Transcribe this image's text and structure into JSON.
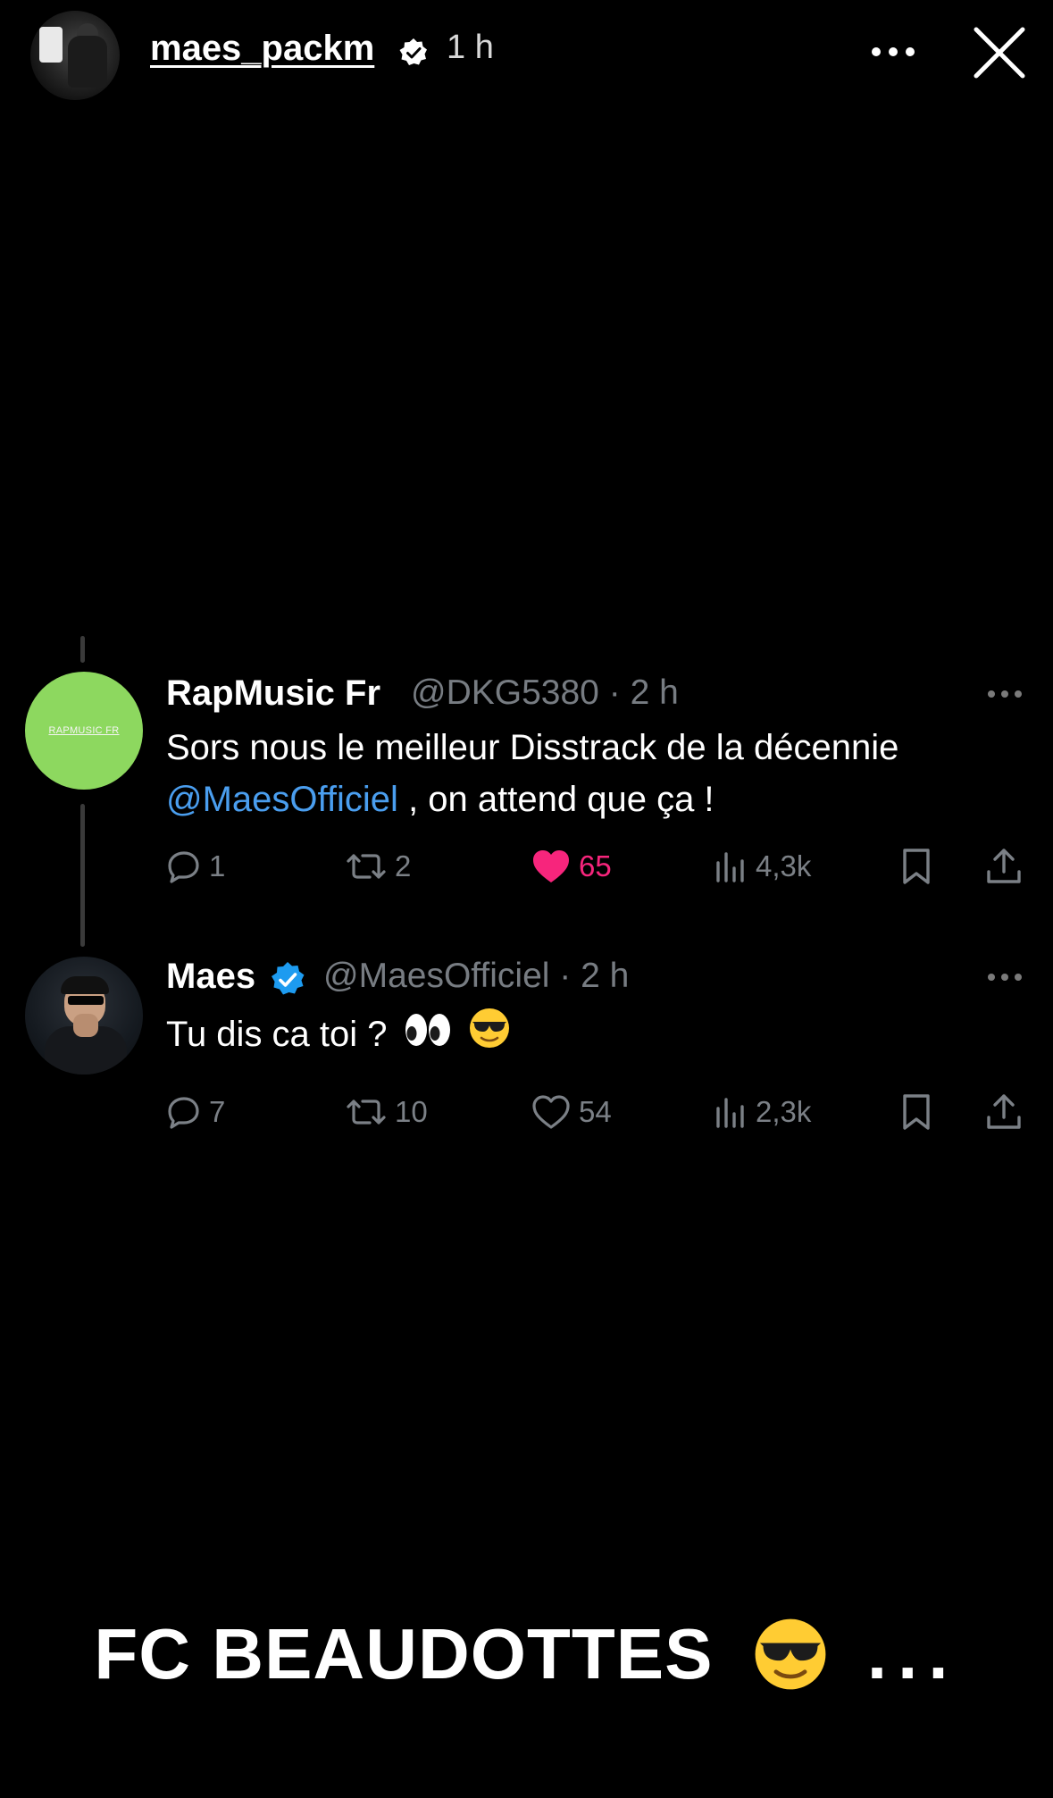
{
  "story": {
    "username": "maes_packm",
    "time": "1 h",
    "verified": true
  },
  "tweets": [
    {
      "name": "RapMusic Fr",
      "handle": "@DKG5380",
      "time_sep": "·",
      "time": "2 h",
      "avatar_text": "RAPMUSIC FR",
      "text_line1": "Sors nous le meilleur  Disstrack  de la décennie",
      "mention": "@MaesOfficiel",
      "text_line2_rest": " , on attend que ça !",
      "replies": "1",
      "retweets": "2",
      "likes": "65",
      "liked": true,
      "views": "4,3k"
    },
    {
      "name": "Maes",
      "verified": true,
      "handle": "@MaesOfficiel",
      "time_sep": "·",
      "time": "2 h",
      "text": "Tu dis ca toi ?",
      "emojis": [
        "eyes-emoji",
        "sunglasses-emoji"
      ],
      "replies": "7",
      "retweets": "10",
      "likes": "54",
      "liked": false,
      "views": "2,3k"
    }
  ],
  "caption": {
    "text": "FC BEAUDOTTES",
    "emoji": "sunglasses-emoji",
    "trailing": "..."
  },
  "colors": {
    "background": "#000000",
    "mention": "#4a9eef",
    "like_active": "#f7257c",
    "muted": "#7b8086",
    "verified_blue": "#1d9bf0",
    "rap_avatar": "#8dd85f"
  }
}
